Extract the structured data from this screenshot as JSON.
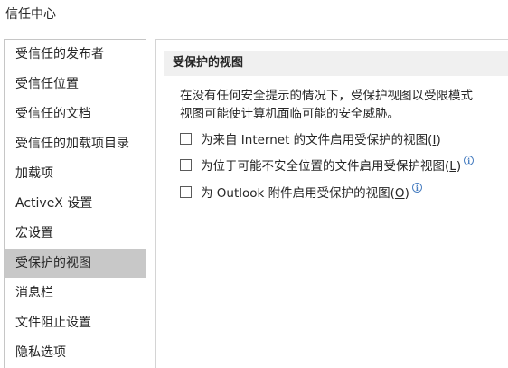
{
  "window": {
    "title": "信任中心"
  },
  "sidebar": {
    "items": [
      {
        "label": "受信任的发布者",
        "selected": false
      },
      {
        "label": "受信任位置",
        "selected": false
      },
      {
        "label": "受信任的文档",
        "selected": false
      },
      {
        "label": "受信任的加载项目录",
        "selected": false
      },
      {
        "label": "加载项",
        "selected": false
      },
      {
        "label": "ActiveX 设置",
        "selected": false
      },
      {
        "label": "宏设置",
        "selected": false
      },
      {
        "label": "受保护的视图",
        "selected": true
      },
      {
        "label": "消息栏",
        "selected": false
      },
      {
        "label": "文件阻止设置",
        "selected": false
      },
      {
        "label": "隐私选项",
        "selected": false
      }
    ]
  },
  "main": {
    "section_title": "受保护的视图",
    "description": [
      "在没有任何安全提示的情况下，受保护视图以受限模式",
      "视图可能使计算机面临可能的安全威胁。"
    ],
    "options": [
      {
        "pre": "为来自 Internet 的文件启用受保护的视图(",
        "key": "I",
        "post": ")",
        "checked": false,
        "info": false
      },
      {
        "pre": "为位于可能不安全位置的文件启用受保护视图(",
        "key": "L",
        "post": ")",
        "checked": false,
        "info": true
      },
      {
        "pre": "为 Outlook 附件启用受保护的视图(",
        "key": "O",
        "post": ")",
        "checked": false,
        "info": true
      }
    ]
  },
  "icons": {
    "info": "info-icon",
    "checkbox": "checkbox-icon"
  },
  "colors": {
    "selected_bg": "#c8c8c8",
    "header_bg": "#f0f0f0",
    "info_blue": "#4a7fc1"
  }
}
